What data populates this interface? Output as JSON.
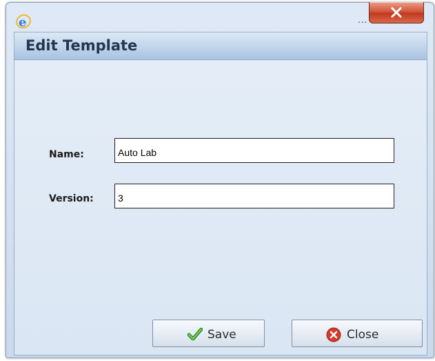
{
  "window": {
    "title_suffix": "...",
    "close_glyph": "X"
  },
  "dialog": {
    "title": "Edit Template"
  },
  "form": {
    "name_label": "Name:",
    "name_value": "Auto Lab",
    "version_label": "Version:",
    "version_value": "3"
  },
  "buttons": {
    "save_label": "Save",
    "close_label": "Close"
  },
  "icons": {
    "app": "ie-icon",
    "save": "checkmark-icon",
    "close": "close-circle-icon"
  },
  "colors": {
    "accent_blue": "#23364f",
    "close_red": "#d4563b",
    "check_green": "#3aa52c"
  }
}
